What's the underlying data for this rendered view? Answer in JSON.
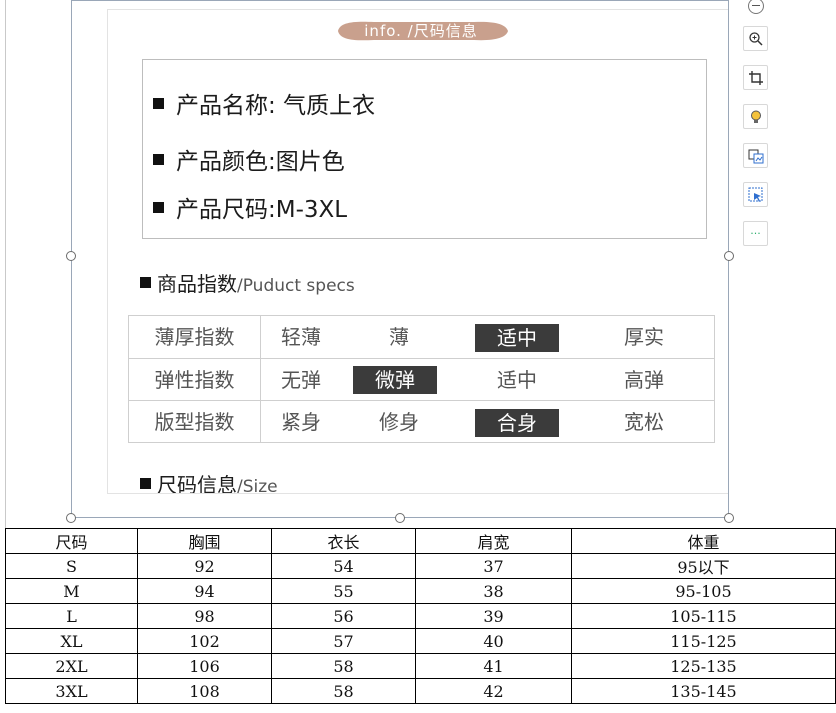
{
  "image": {
    "banner": "info. /尺码信息",
    "product": [
      {
        "label": "产品名称:",
        "value": "气质上衣"
      },
      {
        "label": "产品颜色:",
        "value": "图片色"
      },
      {
        "label": "产品尺码:",
        "value": "M-3XL"
      }
    ],
    "specs_title": "商品指数",
    "specs_sub": "/Puduct specs",
    "specs": [
      {
        "name": "薄厚指数",
        "options": [
          "轻薄",
          "薄",
          "适中",
          "厚实"
        ],
        "selected": 2
      },
      {
        "name": "弹性指数",
        "options": [
          "无弹",
          "微弹",
          "适中",
          "高弹"
        ],
        "selected": 1
      },
      {
        "name": "版型指数",
        "options": [
          "紧身",
          "修身",
          "合身",
          "宽松"
        ],
        "selected": 2
      }
    ],
    "size_title": "尺码信息",
    "size_sub": "/Size"
  },
  "toolbar": {
    "icons": [
      "zoom-icon",
      "crop-icon",
      "bulb-icon",
      "swap-image-icon",
      "select-image-icon",
      "more-icon"
    ],
    "more_label": "···"
  },
  "table": {
    "headers": [
      "尺码",
      "胸围",
      "衣长",
      "肩宽",
      "体重"
    ],
    "rows": [
      [
        "S",
        "92",
        "54",
        "37",
        "95以下"
      ],
      [
        "M",
        "94",
        "55",
        "38",
        "95-105"
      ],
      [
        "L",
        "98",
        "56",
        "39",
        "105-115"
      ],
      [
        "XL",
        "102",
        "57",
        "40",
        "115-125"
      ],
      [
        "2XL",
        "106",
        "58",
        "41",
        "125-135"
      ],
      [
        "3XL",
        "108",
        "58",
        "42",
        "135-145"
      ]
    ]
  },
  "colors": {
    "banner": "#c9a08d",
    "highlight": "#3b3b3b",
    "toolbar_icon": "#2f6fcf"
  }
}
